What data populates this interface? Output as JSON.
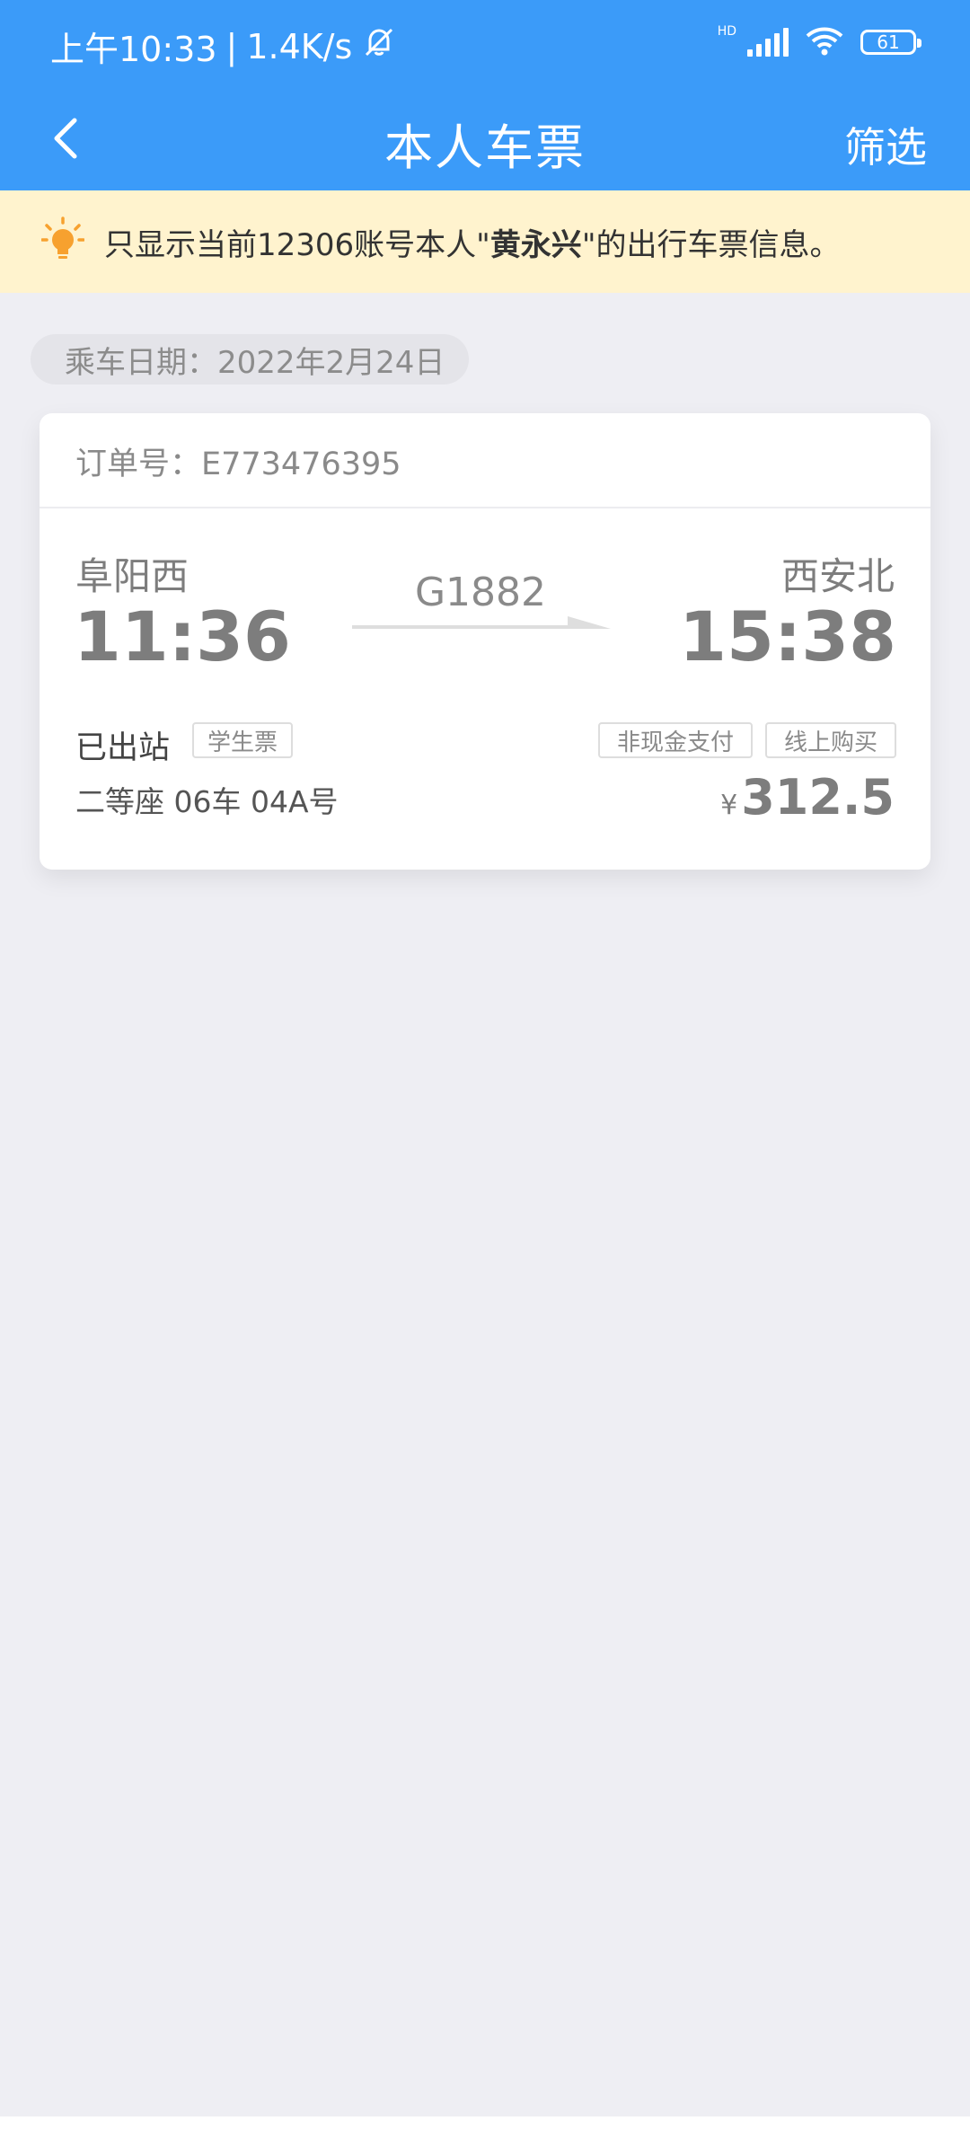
{
  "status": {
    "time": "上午10:33",
    "separator": "|",
    "speed": "1.4K/s",
    "network_tag": "HD",
    "battery": "61"
  },
  "nav": {
    "title": "本人车票",
    "filter_label": "筛选",
    "back_icon": "chevron-left-icon"
  },
  "notice": {
    "icon": "lightbulb-icon",
    "prefix": "只显示当前12306账号本人\"",
    "name": "黄永兴",
    "suffix": "\"的出行车票信息。"
  },
  "date_label": "乘车日期：2022年2月24日",
  "ticket": {
    "order_no": "订单号：E773476395",
    "from_station": "阜阳西",
    "from_time": "11:36",
    "train_no": "G1882",
    "to_station": "西安北",
    "to_time": "15:38",
    "status": "已出站",
    "ticket_type": "学生票",
    "payment_tag": "非现金支付",
    "channel_tag": "线上购买",
    "seat_info": "二等座 06车 04A号",
    "currency": "¥",
    "price": "312.5"
  },
  "colors": {
    "primary": "#3b9bf9",
    "notice_bg": "#fff3ce",
    "page_bg": "#eeeef3",
    "bulb": "#f7a12f"
  }
}
